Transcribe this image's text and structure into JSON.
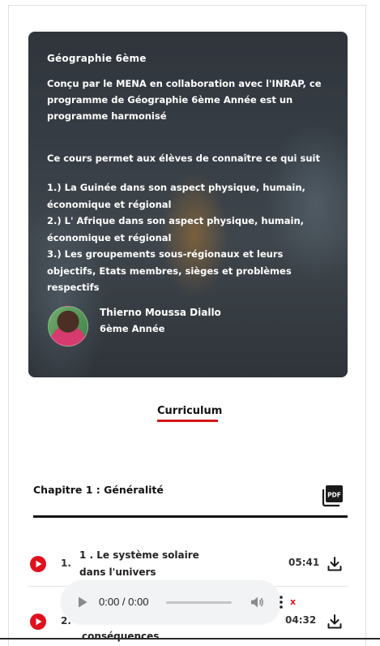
{
  "course": {
    "title": "Géographie 6ème",
    "description": "Conçu par le MENA en collaboration avec l'INRAP, ce programme de Géographie 6ème Année est un programme harmonisé",
    "intro": "Ce cours permet aux élèves de connaître ce qui suit",
    "objectives": [
      "1.) La Guinée dans son aspect physique, humain, économique et régional",
      "2.) L' Afrique dans son aspect physique, humain, économique et régional",
      "3.) Les groupements sous-régionaux et leurs objectifs, Etats membres, sièges et problèmes respectifs"
    ],
    "author": {
      "name": "Thierno Moussa Diallo",
      "grade": "6ème Année"
    }
  },
  "tabs": {
    "curriculum": "Curriculum"
  },
  "chapter": {
    "title": "Chapitre 1 : Généralité",
    "pdf_icon": "pdf-icon",
    "lessons": [
      {
        "number": "1.",
        "title": "1 . Le système solaire dans l'univers",
        "duration": "05:41"
      },
      {
        "number": "2.",
        "title": "conséquences",
        "duration": "04:32"
      }
    ]
  },
  "player": {
    "time": "0:00 / 0:00",
    "close": "x"
  },
  "colors": {
    "accent": "#d01717",
    "play_button": "#e0111f",
    "text_dark": "#111111"
  }
}
